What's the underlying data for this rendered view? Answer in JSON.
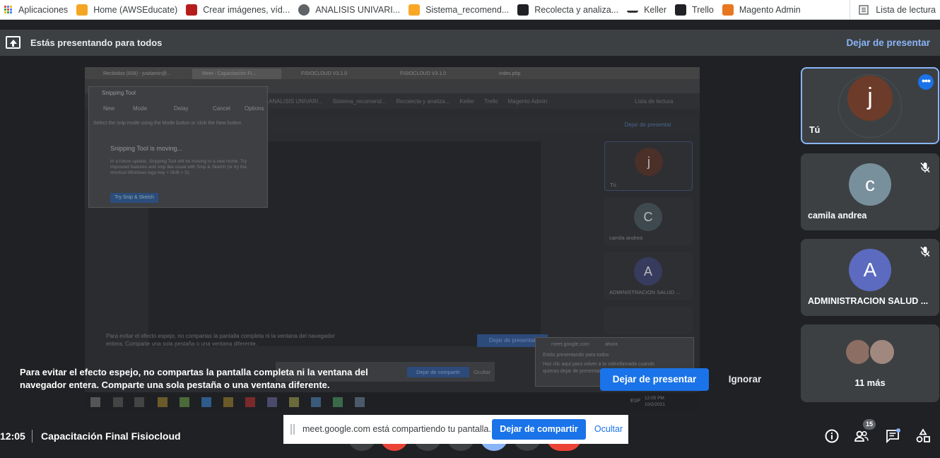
{
  "bookmarks": {
    "items": [
      {
        "label": "Aplicaciones",
        "icon": "apps-grid-icon"
      },
      {
        "label": "Home (AWSEducate)",
        "icon": "cube-icon"
      },
      {
        "label": "Crear imágenes, víd...",
        "icon": "spark-icon"
      },
      {
        "label": "ANALISIS UNIVARI...",
        "icon": "globe-icon"
      },
      {
        "label": "Sistema_recomend...",
        "icon": "notebook-icon"
      },
      {
        "label": "Recolecta y analiza...",
        "icon": "drive-icon"
      },
      {
        "label": "Keller",
        "icon": "keller-icon"
      },
      {
        "label": "Trello",
        "icon": "trello-icon"
      },
      {
        "label": "Magento Admin",
        "icon": "magento-icon"
      }
    ],
    "reading_list": "Lista de lectura"
  },
  "presenting": {
    "text": "Estás presentando para todos",
    "stop_label": "Dejar de presentar"
  },
  "shared_screen": {
    "tabs": [
      "Recibidos (839) - jvsdamin@...",
      "Meet - Capacitación Fi...",
      "FISIOCLOUD V3.1.0",
      "FISIOCLOUD V3.1.0",
      "index.php"
    ],
    "bookmarks": [
      "ANALISIS UNIVARI...",
      "Sistema_recomend...",
      "Recolecta y analiza...",
      "Keller",
      "Trello",
      "Magento Admin",
      "Lista de lectura"
    ],
    "banner_stop": "Dejar de presentar",
    "snip_title": "Snipping Tool",
    "snip_tools": [
      "New",
      "Mode",
      "Delay",
      "Cancel",
      "Options"
    ],
    "snip_desc": "Select the snip mode using the Mode button or click the New button.",
    "snip_moving": "Snipping Tool is moving...",
    "snip_para": "In a future update, Snipping Tool will be moving to a new home. Try improved features and snip like usual with Snip & Sketch (or try the shortcut Windows logo key + Shift + S).",
    "snip_button": "Try Snip & Sketch",
    "tiles": [
      {
        "initial": "j",
        "name": "Tú"
      },
      {
        "initial": "C",
        "name": "camila andrea"
      },
      {
        "initial": "A",
        "name": "ADMINISTRACION SALUD ..."
      }
    ],
    "warn": "Para evitar el efecto espejo, no compartas la pantalla completa ni la ventana del navegador entera. Comparte una sola pestaña o una ventana diferente.",
    "dp_button": "Dejar de presentar",
    "notif_source": "meet.google.com",
    "notif_time": "ahora",
    "notif_title": "Estás presentando para todos",
    "notif_body": "Haz clic aquí para volver a la videollamada cuando quieras dejar de presentar",
    "share_stop": "Dejar de compartir",
    "share_hide": "Ocultar",
    "clock_time": "12:05 PM",
    "clock_date": "10/2/2021",
    "lang": "ESP"
  },
  "mirror_warning": {
    "text": "Para evitar el efecto espejo, no compartas la pantalla completa ni la ventana del navegador entera. Comparte una sola pestaña o una ventana diferente.",
    "stop_label": "Dejar de presentar",
    "ignore_label": "Ignorar"
  },
  "participants": [
    {
      "initial": "j",
      "name": "Tú",
      "color": "#6d3b2a"
    },
    {
      "initial": "c",
      "name": "camila andrea",
      "color": "#78909c"
    },
    {
      "initial": "A",
      "name": "ADMINISTRACION SALUD ...",
      "color": "#5c6bc0"
    }
  ],
  "more_tile": {
    "label": "11 más"
  },
  "bottom": {
    "time": "12:05",
    "meeting_title": "Capacitación Final Fisiocloud",
    "people_count": "15"
  },
  "share_popup": {
    "text": "meet.google.com está compartiendo tu pantalla.",
    "stop_label": "Dejar de compartir",
    "hide_label": "Ocultar"
  },
  "colors": {
    "accent": "#1a73e8",
    "link": "#8ab4f8",
    "background": "#202124",
    "tile": "#3c4043"
  }
}
